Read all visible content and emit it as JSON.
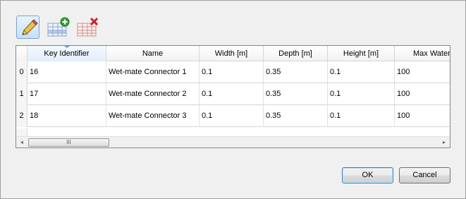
{
  "toolbar": {
    "buttons": [
      {
        "icon": "pencil-edit-icon",
        "active": true
      },
      {
        "icon": "add-row-icon"
      },
      {
        "icon": "delete-row-icon"
      }
    ]
  },
  "table": {
    "columns": [
      "Key Identifier",
      "Name",
      "Width [m]",
      "Depth [m]",
      "Height [m]",
      "Max Water"
    ],
    "rows": [
      {
        "index": "0",
        "cells": [
          "16",
          "Wet-mate Connector 1",
          "0.1",
          "0.35",
          "0.1",
          "100"
        ]
      },
      {
        "index": "1",
        "cells": [
          "17",
          "Wet-mate Connector 2",
          "0.1",
          "0.35",
          "0.1",
          "100"
        ]
      },
      {
        "index": "2",
        "cells": [
          "18",
          "Wet-mate Connector 3",
          "0.1",
          "0.35",
          "0.1",
          "100"
        ]
      }
    ],
    "scrollbar": {
      "left_arrow": "◂",
      "right_arrow": "▸",
      "thumb_grip": "III"
    }
  },
  "buttons": {
    "ok": "OK",
    "cancel": "Cancel"
  },
  "colors": {
    "header_selected": "#e3eefb",
    "border": "#828790",
    "accent": "#3c7fb1"
  }
}
